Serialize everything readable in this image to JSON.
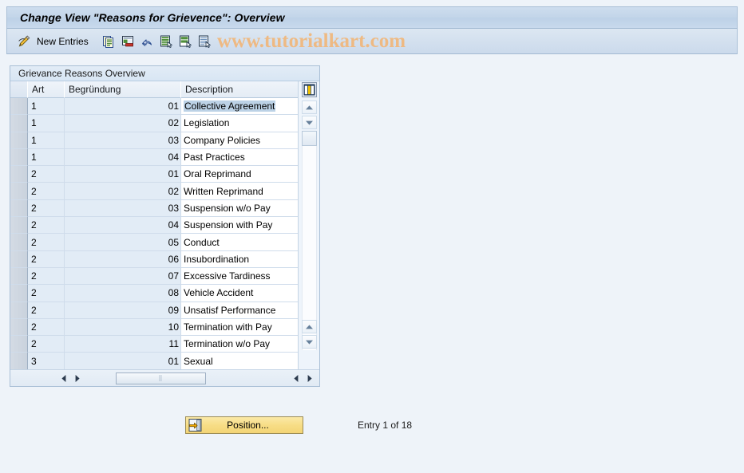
{
  "window": {
    "title": "Change View \"Reasons for Grievence\": Overview"
  },
  "watermark": {
    "text": "www.tutorialkart.com",
    "color": "#f0b87e"
  },
  "toolbar": {
    "edit_icon": "pencil-icon",
    "new_entries_label": "New Entries",
    "buttons": [
      {
        "icon": "copy-icon",
        "name": "copy-as-button"
      },
      {
        "icon": "delete-icon",
        "name": "delete-button"
      },
      {
        "icon": "undo-icon",
        "name": "undo-button"
      },
      {
        "icon": "select-all-icon",
        "name": "select-all-button"
      },
      {
        "icon": "deselect-all-icon",
        "name": "deselect-all-button"
      },
      {
        "icon": "details-icon",
        "name": "details-button"
      }
    ]
  },
  "panel": {
    "title": "Grievance Reasons Overview",
    "settings_icon": "table-settings-icon",
    "columns": [
      {
        "key": "art",
        "label": "Art"
      },
      {
        "key": "beg",
        "label": "Begründung"
      },
      {
        "key": "desc",
        "label": "Description"
      }
    ],
    "rows": [
      {
        "art": "1",
        "beg": "01",
        "desc": "Collective Agreement",
        "selected": true
      },
      {
        "art": "1",
        "beg": "02",
        "desc": "Legislation",
        "selected": false
      },
      {
        "art": "1",
        "beg": "03",
        "desc": "Company Policies",
        "selected": false
      },
      {
        "art": "1",
        "beg": "04",
        "desc": "Past Practices",
        "selected": false
      },
      {
        "art": "2",
        "beg": "01",
        "desc": "Oral Reprimand",
        "selected": false
      },
      {
        "art": "2",
        "beg": "02",
        "desc": "Written Reprimand",
        "selected": false
      },
      {
        "art": "2",
        "beg": "03",
        "desc": "Suspension w/o Pay",
        "selected": false
      },
      {
        "art": "2",
        "beg": "04",
        "desc": "Suspension with Pay",
        "selected": false
      },
      {
        "art": "2",
        "beg": "05",
        "desc": "Conduct",
        "selected": false
      },
      {
        "art": "2",
        "beg": "06",
        "desc": "Insubordination",
        "selected": false
      },
      {
        "art": "2",
        "beg": "07",
        "desc": "Excessive Tardiness",
        "selected": false
      },
      {
        "art": "2",
        "beg": "08",
        "desc": "Vehicle Accident",
        "selected": false
      },
      {
        "art": "2",
        "beg": "09",
        "desc": "Unsatisf Performance",
        "selected": false
      },
      {
        "art": "2",
        "beg": "10",
        "desc": "Termination with Pay",
        "selected": false
      },
      {
        "art": "2",
        "beg": "11",
        "desc": "Termination w/o Pay",
        "selected": false
      },
      {
        "art": "3",
        "beg": "01",
        "desc": "Sexual",
        "selected": false
      }
    ]
  },
  "footer": {
    "position_label": "Position...",
    "position_icon": "position-icon",
    "entry_status": "Entry 1 of 18"
  }
}
